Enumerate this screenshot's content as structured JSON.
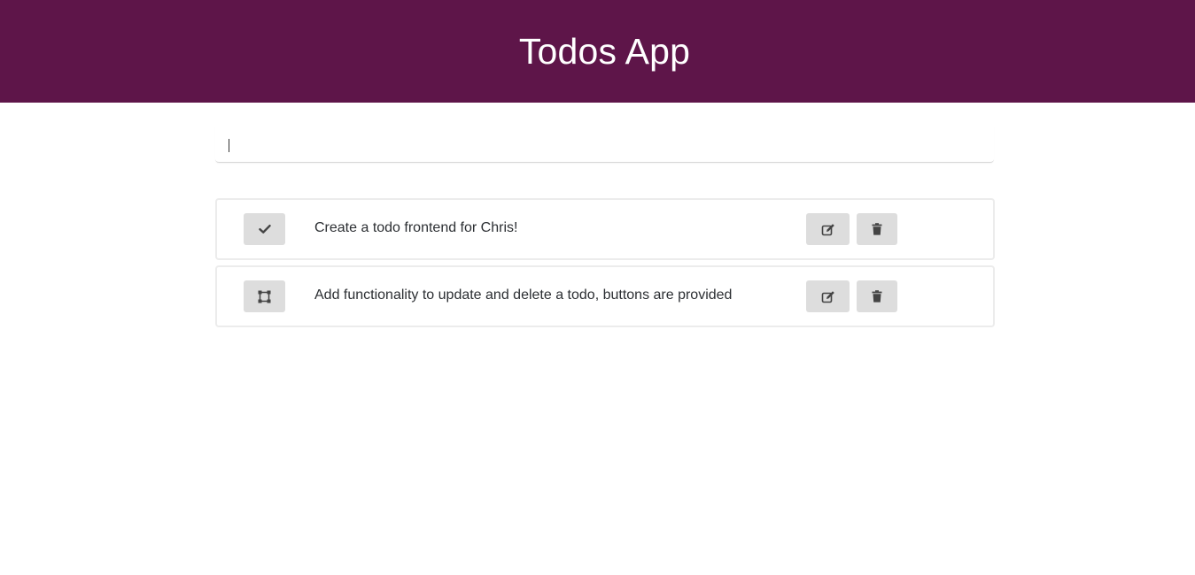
{
  "header": {
    "title": "Todos App",
    "background_color": "#5e1549"
  },
  "new_todo": {
    "value": "",
    "placeholder": ""
  },
  "todos": [
    {
      "text": "Create a todo frontend for Chris!",
      "completed": true,
      "toggle_icon": "check-icon",
      "edit_icon": "edit-icon",
      "delete_icon": "trash-icon"
    },
    {
      "text": "Add functionality to update and delete a todo, buttons are provided",
      "completed": false,
      "toggle_icon": "square-icon",
      "edit_icon": "edit-icon",
      "delete_icon": "trash-icon"
    }
  ]
}
